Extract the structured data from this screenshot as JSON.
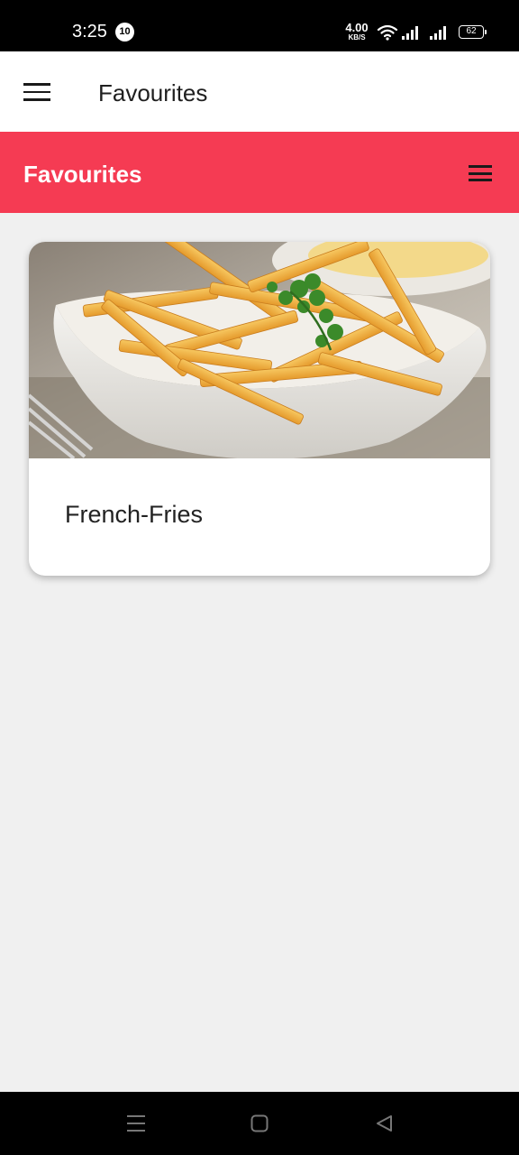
{
  "status_bar": {
    "time": "3:25",
    "notification_count": "10",
    "net_speed_value": "4.00",
    "net_speed_unit": "KB/S",
    "battery_level": "62",
    "icons": [
      "wifi-icon",
      "signal-icon",
      "signal-icon",
      "battery-icon"
    ]
  },
  "app_bar": {
    "title": "Favourites",
    "menu_icon": "hamburger-icon"
  },
  "header": {
    "title": "Favourites",
    "menu_icon": "hamburger-icon",
    "background_color": "#f53b53"
  },
  "favourites": [
    {
      "title": "French-Fries",
      "image": "french-fries-photo"
    }
  ],
  "nav_bar": {
    "icons": [
      "recent-apps-icon",
      "home-icon",
      "back-icon"
    ]
  }
}
